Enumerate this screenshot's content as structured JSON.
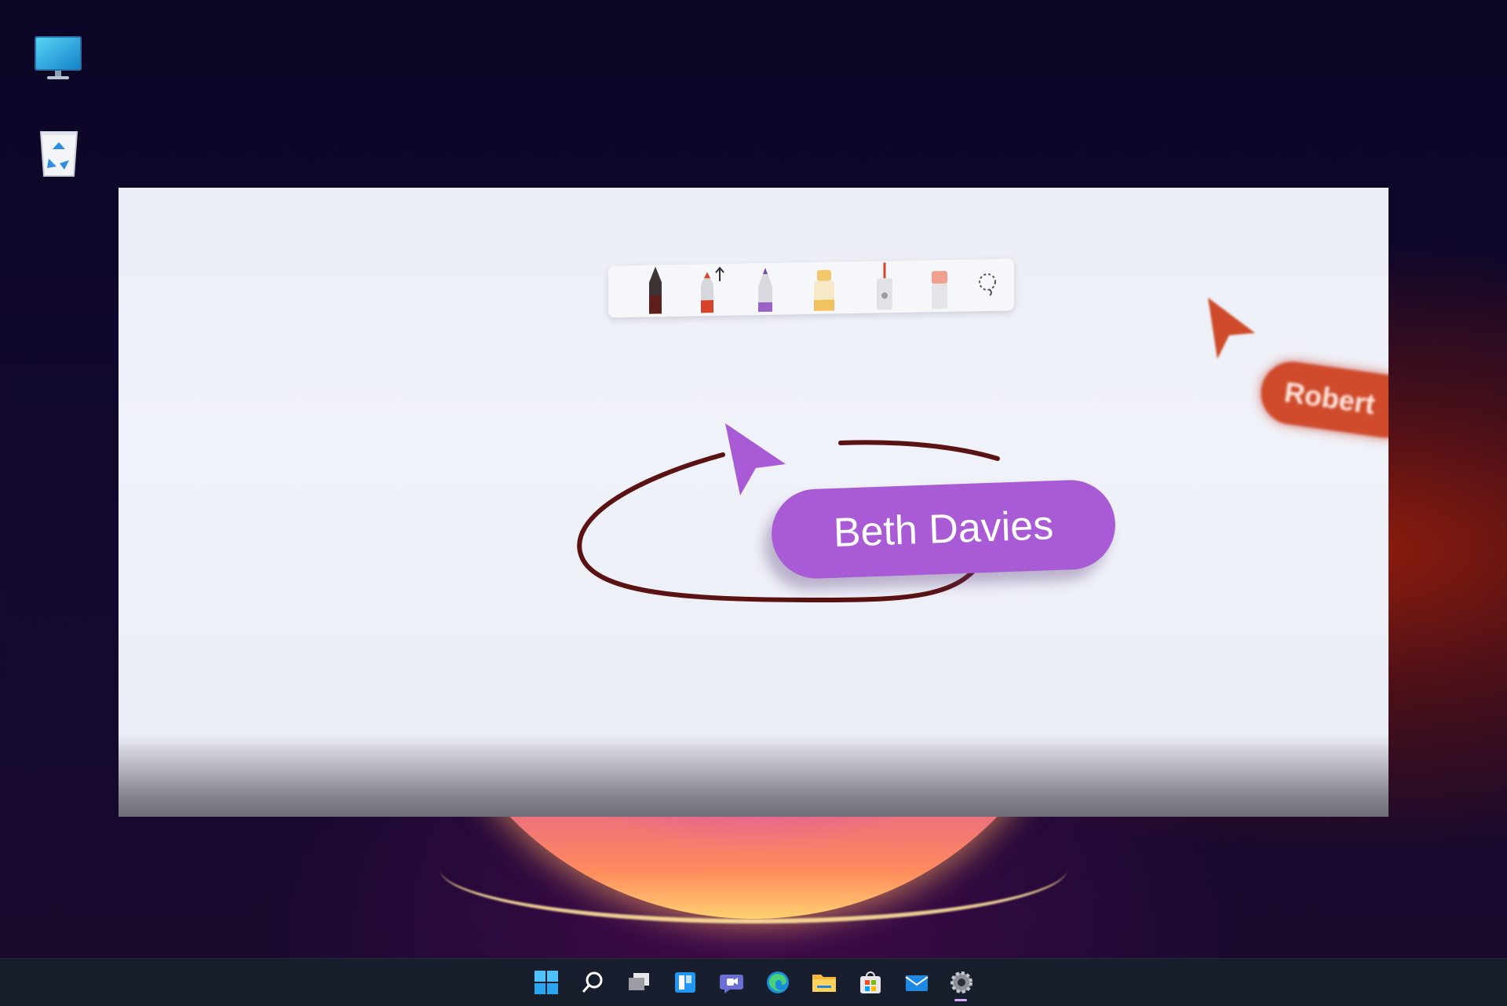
{
  "desktop": {
    "icons": [
      "this-pc-icon",
      "recycle-bin-icon"
    ]
  },
  "media": {
    "toolbar_tools": [
      "pen-dark-icon",
      "pen-orange-icon",
      "pencil-purple-icon",
      "highlighter-yellow-icon",
      "ruler-icon",
      "eraser-icon",
      "lasso-icon"
    ],
    "cursor_beth": {
      "name": "Beth Davies",
      "color": "#a85bd4"
    },
    "cursor_robert": {
      "name": "Robert",
      "color": "#cf4b2c"
    },
    "ink_color": "#5a1212"
  },
  "taskbar": {
    "items": [
      "start-icon",
      "search-icon",
      "task-view-icon",
      "widgets-icon",
      "teams-chat-icon",
      "edge-icon",
      "file-explorer-icon",
      "store-icon",
      "mail-icon",
      "settings-icon"
    ],
    "active_item": "settings-icon",
    "accent": "#d6a6ff"
  }
}
